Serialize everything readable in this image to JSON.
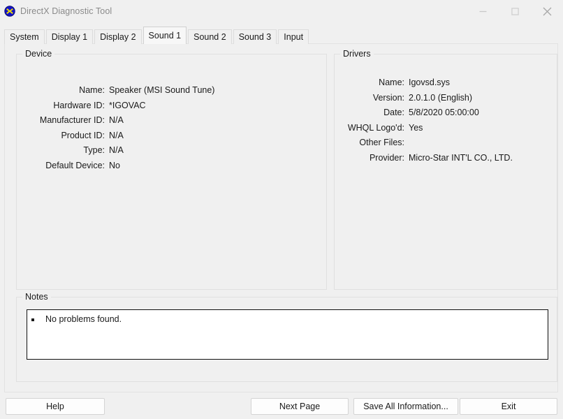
{
  "window": {
    "title": "DirectX Diagnostic Tool",
    "icon": "directx-app-icon",
    "controls": {
      "minimize": "minimize-icon",
      "maximize": "maximize-icon",
      "close": "close-icon"
    }
  },
  "tabs": [
    {
      "label": "System",
      "active": false
    },
    {
      "label": "Display 1",
      "active": false
    },
    {
      "label": "Display 2",
      "active": false
    },
    {
      "label": "Sound 1",
      "active": true
    },
    {
      "label": "Sound 2",
      "active": false
    },
    {
      "label": "Sound 3",
      "active": false
    },
    {
      "label": "Input",
      "active": false
    }
  ],
  "device": {
    "group_label": "Device",
    "fields": [
      {
        "label": "Name:",
        "value": "Speaker (MSI Sound Tune)"
      },
      {
        "label": "Hardware ID:",
        "value": "*IGOVAC"
      },
      {
        "label": "Manufacturer ID:",
        "value": "N/A"
      },
      {
        "label": "Product ID:",
        "value": "N/A"
      },
      {
        "label": "Type:",
        "value": "N/A"
      },
      {
        "label": "Default Device:",
        "value": "No"
      }
    ]
  },
  "drivers": {
    "group_label": "Drivers",
    "fields": [
      {
        "label": "Name:",
        "value": "Igovsd.sys"
      },
      {
        "label": "Version:",
        "value": "2.0.1.0 (English)"
      },
      {
        "label": "Date:",
        "value": "5/8/2020 05:00:00"
      },
      {
        "label": "WHQL Logo'd:",
        "value": "Yes"
      },
      {
        "label": "Other Files:",
        "value": ""
      },
      {
        "label": "Provider:",
        "value": "Micro-Star INT'L CO., LTD."
      }
    ]
  },
  "notes": {
    "group_label": "Notes",
    "lines": [
      {
        "text": "No problems found."
      }
    ]
  },
  "buttons": {
    "help": "Help",
    "next_page": "Next Page",
    "save_all": "Save All Information...",
    "exit": "Exit"
  },
  "colors": {
    "window_background": "#f0f0f0",
    "text": "#1a1a1a",
    "title_text": "#8a8a8a",
    "icon_disc": "#1414c8",
    "icon_x": "#f0e000",
    "group_border": "#e0e0e0",
    "notes_border": "#111111",
    "notes_background": "#ffffff",
    "button_face": "#fdfdfd",
    "button_border": "#d4d4d4",
    "active_tab_face": "#f7f7f7"
  }
}
